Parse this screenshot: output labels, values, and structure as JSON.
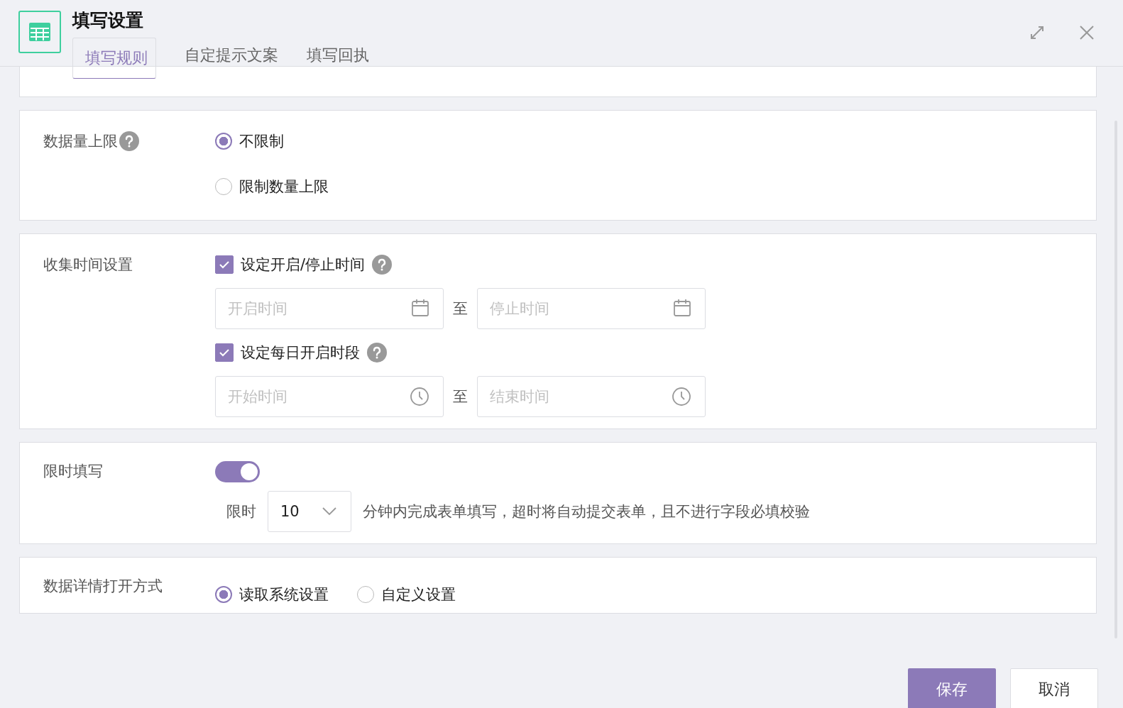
{
  "dialog": {
    "title": "填写设置"
  },
  "tabs": [
    {
      "label": "填写规则",
      "selected": true
    },
    {
      "label": "自定提示文案",
      "selected": false
    },
    {
      "label": "填写回执",
      "selected": false
    }
  ],
  "data_limit": {
    "label": "数据量上限",
    "options": [
      {
        "label": "不限制",
        "selected": true
      },
      {
        "label": "限制数量上限",
        "selected": false
      }
    ]
  },
  "collect_time": {
    "label": "收集时间设置",
    "groups": [
      {
        "label": "设定开启/停止时间",
        "checked": true,
        "kind": "date",
        "from": {
          "placeholder": "开启时间"
        },
        "separator": "至",
        "to": {
          "placeholder": "停止时间"
        }
      },
      {
        "label": "设定每日开启时段",
        "checked": true,
        "kind": "time",
        "from": {
          "placeholder": "开始时间"
        },
        "separator": "至",
        "to": {
          "placeholder": "结束时间"
        }
      }
    ]
  },
  "time_limit": {
    "label": "限时填写",
    "on": true,
    "prefix": "限时",
    "value": "10",
    "suffix": "分钟内完成表单填写，超时将自动提交表单，且不进行字段必填校验"
  },
  "detail_open": {
    "label": "数据详情打开方式",
    "options": [
      {
        "label": "读取系统设置",
        "selected": true
      },
      {
        "label": "自定义设置",
        "selected": false
      }
    ]
  },
  "buttons": [
    {
      "label": "保存",
      "kind": "primary"
    },
    {
      "label": "取消",
      "kind": "secondary"
    }
  ]
}
